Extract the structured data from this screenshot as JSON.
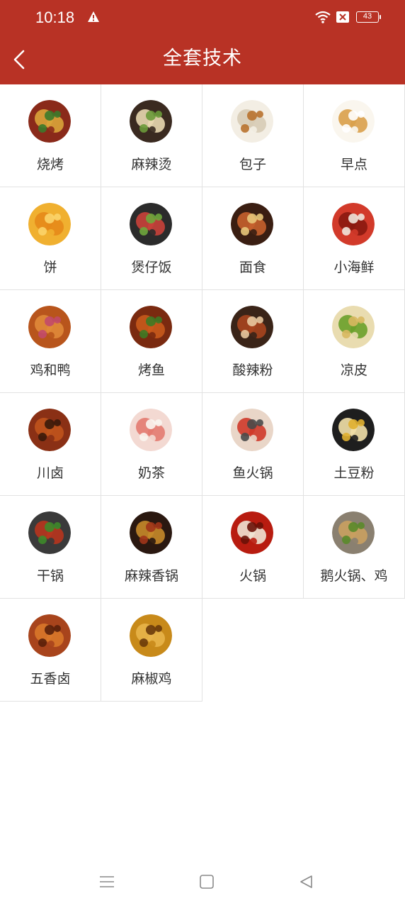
{
  "status_bar": {
    "time": "10:18",
    "battery": "43"
  },
  "app_bar": {
    "title": "全套技术"
  },
  "colors": {
    "accent": "#b83225",
    "divider": "#e2e2e2",
    "label": "#333333"
  },
  "items": [
    {
      "label": "烧烤",
      "image": "bbq-skewers",
      "c1": "#8a2a1a",
      "c2": "#d9a43a",
      "c3": "#3b7a2b"
    },
    {
      "label": "麻辣烫",
      "image": "malatang-platter",
      "c1": "#3a2a20",
      "c2": "#e9d8b0",
      "c3": "#6b9a3a"
    },
    {
      "label": "包子",
      "image": "steamed-buns",
      "c1": "#f3eee4",
      "c2": "#d7cbb5",
      "c3": "#b8712e"
    },
    {
      "label": "早点",
      "image": "breakfast-fritters-soymilk",
      "c1": "#faf6ee",
      "c2": "#d9a04a",
      "c3": "#ffffff"
    },
    {
      "label": "饼",
      "image": "pancake",
      "c1": "#f0b030",
      "c2": "#e58a1a",
      "c3": "#fbd46a"
    },
    {
      "label": "煲仔饭",
      "image": "claypot-rice",
      "c1": "#2b2b2b",
      "c2": "#c9413a",
      "c3": "#6fa63c"
    },
    {
      "label": "面食",
      "image": "noodles",
      "c1": "#3a1e12",
      "c2": "#c7602d",
      "c3": "#e8c77a"
    },
    {
      "label": "小海鲜",
      "image": "crayfish",
      "c1": "#d23a2a",
      "c2": "#8a1a10",
      "c3": "#f0e6dc"
    },
    {
      "label": "鸡和鸭",
      "image": "roast-duck",
      "c1": "#b8551c",
      "c2": "#e08a3a",
      "c3": "#c24a6a"
    },
    {
      "label": "烤鱼",
      "image": "grilled-fish",
      "c1": "#7a2a10",
      "c2": "#c85a1c",
      "c3": "#3d7a25"
    },
    {
      "label": "酸辣粉",
      "image": "hot-sour-noodles",
      "c1": "#3a2418",
      "c2": "#a8451e",
      "c3": "#e9c9a0"
    },
    {
      "label": "凉皮",
      "image": "cold-noodles",
      "c1": "#e9dcb0",
      "c2": "#6aa02a",
      "c3": "#d8b860"
    },
    {
      "label": "川卤",
      "image": "braised-goose",
      "c1": "#8a3015",
      "c2": "#c0541c",
      "c3": "#3a1a0a"
    },
    {
      "label": "奶茶",
      "image": "milk-tea",
      "c1": "#f3d9d2",
      "c2": "#e37a70",
      "c3": "#faf4ee"
    },
    {
      "label": "鱼火锅",
      "image": "fish-hotpot",
      "c1": "#e9d6c8",
      "c2": "#cf3a2a",
      "c3": "#4a4a4a"
    },
    {
      "label": "土豆粉",
      "image": "potato-noodles",
      "c1": "#1e1e1e",
      "c2": "#f2e0a8",
      "c3": "#e0b030"
    },
    {
      "label": "干锅",
      "image": "dry-pot",
      "c1": "#3a3a3a",
      "c2": "#b8351e",
      "c3": "#3e8a2a"
    },
    {
      "label": "麻辣香锅",
      "image": "spicy-stir-pot",
      "c1": "#2a1810",
      "c2": "#c78a2a",
      "c3": "#a0351a"
    },
    {
      "label": "火锅",
      "image": "hotpot",
      "c1": "#b81c10",
      "c2": "#f0e4d4",
      "c3": "#6a1208"
    },
    {
      "label": "鹅火锅、鸡",
      "image": "goose-hotpot",
      "c1": "#8a8070",
      "c2": "#c9a060",
      "c3": "#5a8a2a"
    },
    {
      "label": "五香卤",
      "image": "spiced-braised-meat",
      "c1": "#a8441c",
      "c2": "#d8782a",
      "c3": "#5a200a"
    },
    {
      "label": "麻椒鸡",
      "image": "pepper-chicken",
      "c1": "#c88a1a",
      "c2": "#e8b44a",
      "c3": "#6a3a0a"
    }
  ]
}
